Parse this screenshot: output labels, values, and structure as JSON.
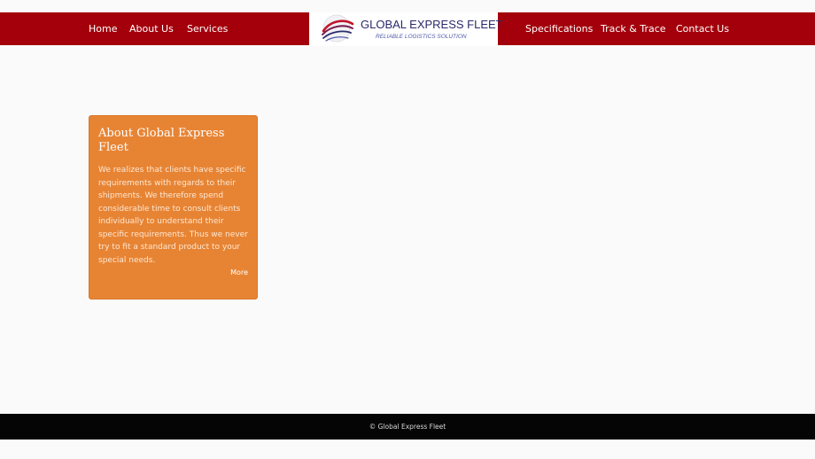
{
  "nav": {
    "left": [
      {
        "label": "Home"
      },
      {
        "label": "About Us"
      },
      {
        "label": "Services"
      }
    ],
    "right": [
      {
        "label": "Specifications"
      },
      {
        "label": "Track & Trace"
      },
      {
        "label": "Contact Us"
      }
    ]
  },
  "logo": {
    "title": "GLOBAL EXPRESS FLEET",
    "tagline": "RELIABLE LOGISTICS SOLUTION",
    "icon": "globe-swoosh-icon",
    "colors": {
      "primary": "#2b2a6b",
      "accent": "#c0152b",
      "tagline": "#4f59a8"
    }
  },
  "about": {
    "title": "About Global Express Fleet",
    "text": "We realizes that clients have specific requirements with regards to their shipments. We therefore spend considerable time to consult clients individually to understand their specific requirements. Thus we never try to fit a standard product to your special needs.",
    "more_label": "More"
  },
  "footer": {
    "text": "© Global Express Fleet"
  },
  "colors": {
    "nav_bg": "#a3000b",
    "card_bg": "#e78434",
    "footer_bg": "#050505",
    "page_bg": "#fafafa"
  }
}
